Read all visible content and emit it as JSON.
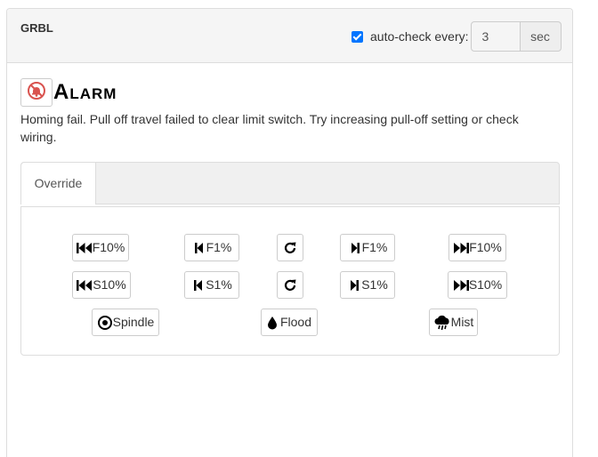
{
  "header": {
    "title": "GRBL",
    "autocheck_label": "auto-check every:",
    "autocheck_checked": true,
    "interval_value": "3",
    "interval_unit": "sec"
  },
  "alarm": {
    "icon": "bell-slash-icon",
    "title": "Alarm",
    "message": "Homing fail. Pull off travel failed to clear limit switch. Try increasing pull-off setting or check wiring."
  },
  "tabs": [
    {
      "label": "Override",
      "active": true
    }
  ],
  "override": {
    "feed": {
      "minus10": "F10%",
      "minus1": "F1%",
      "plus1": "F1%",
      "plus10": "F10%"
    },
    "speed": {
      "minus10": "S10%",
      "minus1": "S1%",
      "plus1": "S1%",
      "plus10": "S10%"
    },
    "toggles": {
      "spindle": "Spindle",
      "flood": "Flood",
      "mist": "Mist"
    }
  },
  "colors": {
    "checkbox": "#0075ff",
    "alarm_icon": "#d9534f",
    "heading_bg": "#f5f5f5",
    "border": "#dddddd"
  }
}
